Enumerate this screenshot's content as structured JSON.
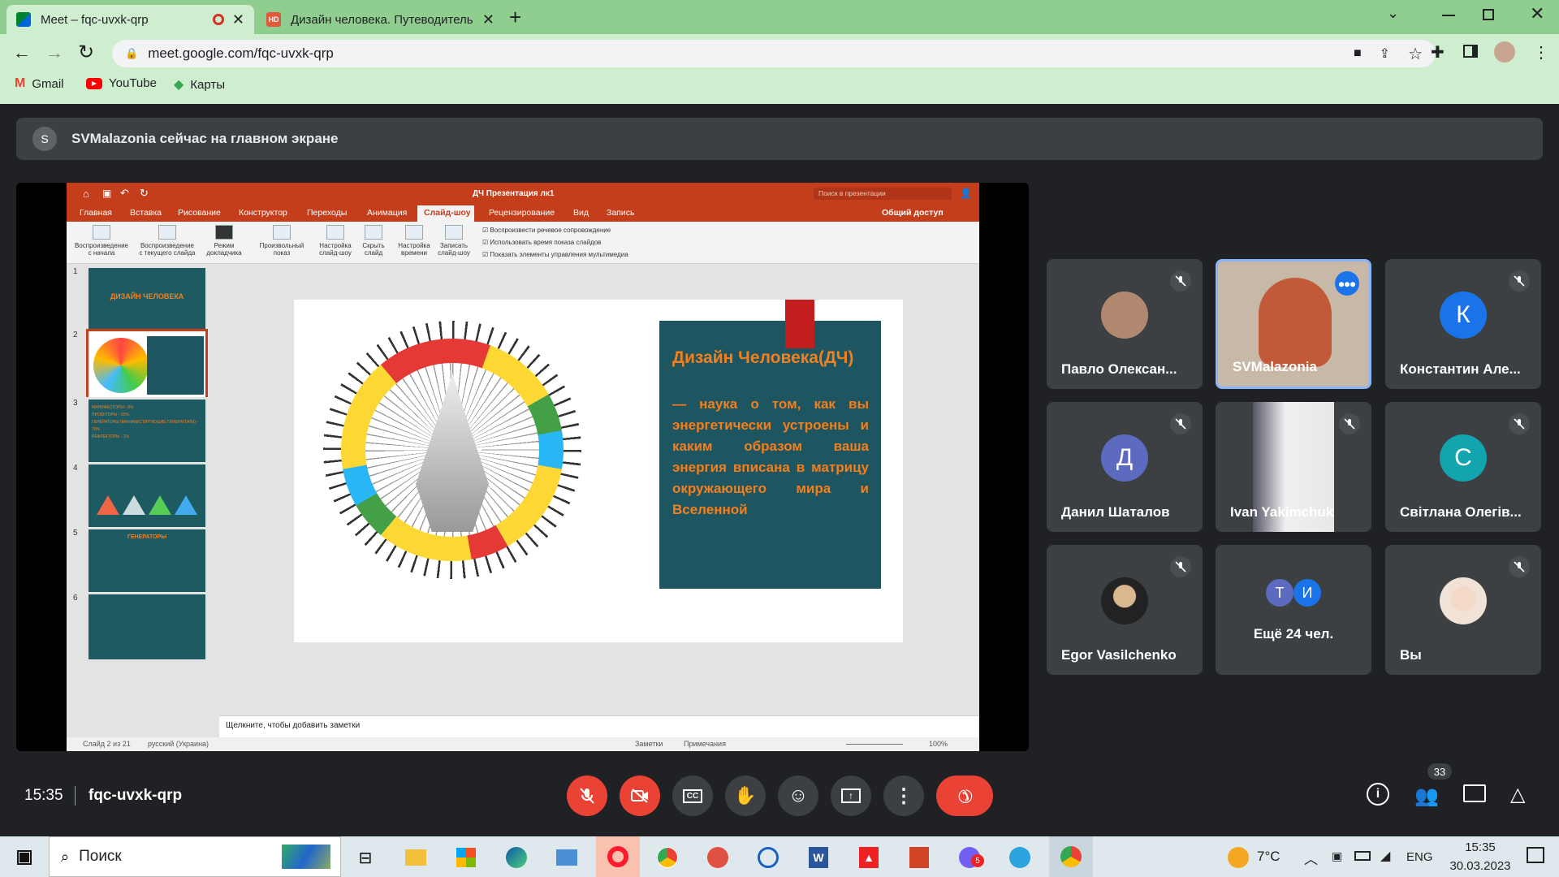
{
  "browser": {
    "tabs": [
      {
        "title": "Meet – fqc-uvxk-qrp",
        "active": true
      },
      {
        "title": "Дизайн человека. Путеводитель",
        "active": false
      }
    ],
    "address": "meet.google.com/fqc-uvxk-qrp",
    "bookmarks": [
      "Gmail",
      "YouTube",
      "Карты"
    ]
  },
  "meet": {
    "banner": {
      "avatar_letter": "S",
      "text": "SVMalazonia сейчас на главном экране"
    },
    "time": "15:35",
    "meeting_code": "fqc-uvxk-qrp",
    "participants_count": "33",
    "tiles": [
      {
        "name": "Павло Олексан...",
        "muted": true,
        "avatar": "photo"
      },
      {
        "name": "SVMalazonia",
        "muted": false,
        "speaking": true,
        "avatar": "video"
      },
      {
        "name": "Константин Але...",
        "muted": true,
        "avatar": "letter",
        "letter": "К",
        "color": "#1a73e8"
      },
      {
        "name": "Данил Шаталов",
        "muted": true,
        "avatar": "letter",
        "letter": "Д",
        "color": "#5c6bc0"
      },
      {
        "name": "Ivan Yakimchuk",
        "muted": true,
        "avatar": "video"
      },
      {
        "name": "Світлана Олегів...",
        "muted": true,
        "avatar": "letter",
        "letter": "С",
        "color": "#12a4af"
      },
      {
        "name": "Egor Vasilchenko",
        "muted": true,
        "avatar": "photo"
      },
      {
        "name": "Ещё 24 чел.",
        "muted": false,
        "avatar": "group",
        "letters": [
          "Т",
          "И"
        ]
      },
      {
        "name": "Вы",
        "muted": true,
        "avatar": "photo"
      }
    ]
  },
  "ppt": {
    "title": "ДЧ Презентация лк1",
    "search_placeholder": "Поиск в презентации",
    "share": "Общий доступ",
    "tabs": [
      "Главная",
      "Вставка",
      "Рисование",
      "Конструктор",
      "Переходы",
      "Анимация",
      "Слайд-шоу",
      "Рецензирование",
      "Вид",
      "Запись"
    ],
    "active_tab": "Слайд-шоу",
    "ribbon_buttons": [
      {
        "l1": "Воспроизведение",
        "l2": "с начала"
      },
      {
        "l1": "Воспроизведение",
        "l2": "с текущего слайда"
      },
      {
        "l1": "Режим",
        "l2": "докладчика"
      },
      {
        "l1": "Произвольный",
        "l2": "показ"
      },
      {
        "l1": "Настройка",
        "l2": "слайд-шоу"
      },
      {
        "l1": "Скрыть",
        "l2": "слайд"
      },
      {
        "l1": "Настройка",
        "l2": "времени"
      },
      {
        "l1": "Записать",
        "l2": "слайд-шоу"
      }
    ],
    "checkboxes": [
      "Воспроизвести речевое сопровождение",
      "Использовать время показа слайдов",
      "Показать элементы управления мультимедиа"
    ],
    "thumb_numbers": [
      "1",
      "2",
      "3",
      "4",
      "5",
      "6"
    ],
    "thumb_texts": {
      "t1": "ДИЗАЙН  ЧЕЛОВЕКА",
      "t3a": "МАНИФЕСТОРЫ - 8%",
      "t3b": "ПРОЕКТОРЫ - 20%",
      "t3c": "ГЕНЕРАТОРЫ (МАНИФЕСТИРУЮЩИЕ ГЕНЕРАТОРЫ) - 70%",
      "t3d": "РЕФЛЕКТОРЫ - 1%",
      "t5": "ГЕНЕРАТОРЫ"
    },
    "slide": {
      "heading": "Дизайн Человека(ДЧ)",
      "body": "— наука о том, как вы энергетически устроены и каким образом ваша энергия вписана в матрицу окружающего мира и Вселенной"
    },
    "notes_placeholder": "Щелкните, чтобы добавить заметки",
    "status_left": "Слайд 2 из 21",
    "status_lang": "русский (Украина)",
    "status_notes": "Заметки",
    "status_comments": "Примечания",
    "zoom": "100%"
  },
  "taskbar": {
    "search": "Поиск",
    "weather": "7°C",
    "lang": "ENG",
    "time": "15:35",
    "date": "30.03.2023",
    "viber_badge": "5"
  },
  "colors": {
    "browser_green": "#8fce8f",
    "meet_bg": "#202124",
    "tile_bg": "#3c4043",
    "red": "#ea4335",
    "ppt_red": "#c43e1c",
    "slide_teal": "#1d5560",
    "slide_text": "#f47f1c"
  }
}
